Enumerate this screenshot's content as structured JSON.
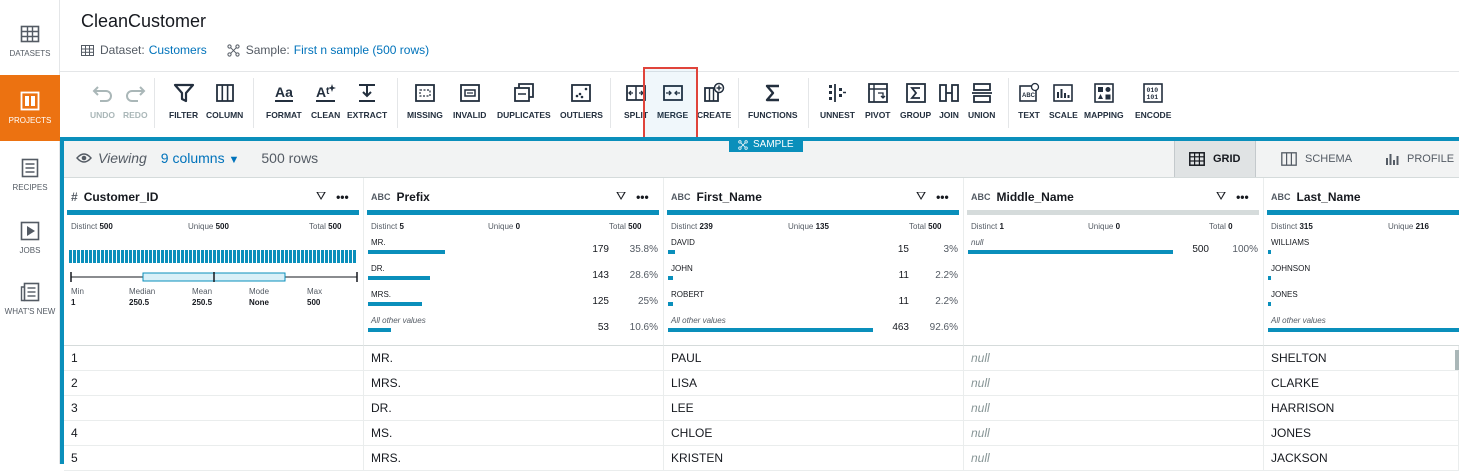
{
  "sidebar": {
    "items": [
      {
        "label": "DATASETS",
        "icon": "table-icon"
      },
      {
        "label": "PROJECTS",
        "icon": "grid-icon"
      },
      {
        "label": "RECIPES",
        "icon": "list-icon"
      },
      {
        "label": "JOBS",
        "icon": "play-icon"
      },
      {
        "label": "WHAT'S NEW",
        "icon": "news-icon"
      }
    ]
  },
  "header": {
    "title": "CleanCustomer",
    "dataset_label": "Dataset:",
    "dataset_value": "Customers",
    "sample_label": "Sample:",
    "sample_value": "First n sample (500 rows)"
  },
  "toolbar": {
    "undo": "UNDO",
    "redo": "REDO",
    "filter": "FILTER",
    "column": "COLUMN",
    "format": "FORMAT",
    "clean": "CLEAN",
    "extract": "EXTRACT",
    "missing": "MISSING",
    "invalid": "INVALID",
    "duplicates": "DUPLICATES",
    "outliers": "OUTLIERS",
    "split": "SPLIT",
    "merge": "MERGE",
    "create": "CREATE",
    "functions": "FUNCTIONS",
    "unnest": "UNNEST",
    "pivot": "PIVOT",
    "group": "GROUP",
    "join": "JOIN",
    "union": "UNION",
    "text": "TEXT",
    "scale": "SCALE",
    "mapping": "MAPPING",
    "encode": "ENCODE"
  },
  "sample_tag": "SAMPLE",
  "viewbar": {
    "viewing": "Viewing",
    "columns": "9 columns",
    "rows": "500 rows",
    "tabs": [
      "GRID",
      "SCHEMA",
      "PROFILE"
    ]
  },
  "columns": [
    {
      "name": "Customer_ID",
      "type": "#",
      "distinct_label": "Distinct",
      "distinct": "500",
      "unique_label": "Unique",
      "unique": "500",
      "total_label": "Total",
      "total": "500",
      "summary": {
        "min_label": "Min",
        "min": "1",
        "median_label": "Median",
        "median": "250.5",
        "mean_label": "Mean",
        "mean": "250.5",
        "mode_label": "Mode",
        "mode": "None",
        "max_label": "Max",
        "max": "500"
      }
    },
    {
      "name": "Prefix",
      "type": "ABC",
      "distinct_label": "Distinct",
      "distinct": "5",
      "unique_label": "Unique",
      "unique": "0",
      "total_label": "Total",
      "total": "500",
      "values": [
        {
          "label": "MR.",
          "count": "179",
          "pct": "35.8%",
          "frac": 0.358
        },
        {
          "label": "DR.",
          "count": "143",
          "pct": "28.6%",
          "frac": 0.286
        },
        {
          "label": "MRS.",
          "count": "125",
          "pct": "25%",
          "frac": 0.25
        },
        {
          "label": "All other values",
          "count": "53",
          "pct": "10.6%",
          "frac": 0.106
        }
      ]
    },
    {
      "name": "First_Name",
      "type": "ABC",
      "distinct_label": "Distinct",
      "distinct": "239",
      "unique_label": "Unique",
      "unique": "135",
      "total_label": "Total",
      "total": "500",
      "values": [
        {
          "label": "DAVID",
          "count": "15",
          "pct": "3%",
          "frac": 0.03
        },
        {
          "label": "JOHN",
          "count": "11",
          "pct": "2.2%",
          "frac": 0.022
        },
        {
          "label": "ROBERT",
          "count": "11",
          "pct": "2.2%",
          "frac": 0.022
        },
        {
          "label": "All other values",
          "count": "463",
          "pct": "92.6%",
          "frac": 0.926
        }
      ]
    },
    {
      "name": "Middle_Name",
      "type": "ABC",
      "distinct_label": "Distinct",
      "distinct": "1",
      "unique_label": "Unique",
      "unique": "0",
      "total_label": "Total",
      "total": "0",
      "values": [
        {
          "label": "null",
          "count": "500",
          "pct": "100%",
          "frac": 1.0
        }
      ]
    },
    {
      "name": "Last_Name",
      "type": "ABC",
      "distinct_label": "Distinct",
      "distinct": "315",
      "unique_label": "Unique",
      "unique": "216",
      "values": [
        {
          "label": "WILLIAMS",
          "frac": 0.01
        },
        {
          "label": "JOHNSON",
          "frac": 0.01
        },
        {
          "label": "JONES",
          "frac": 0.01
        },
        {
          "label": "All other values",
          "frac": 0.97
        }
      ]
    }
  ],
  "rows": [
    [
      "1",
      "MR.",
      "PAUL",
      "null",
      "SHELTON"
    ],
    [
      "2",
      "MRS.",
      "LISA",
      "null",
      "CLARKE"
    ],
    [
      "3",
      "DR.",
      "LEE",
      "null",
      "HARRISON"
    ],
    [
      "4",
      "MS.",
      "CHLOE",
      "null",
      "JONES"
    ],
    [
      "5",
      "MRS.",
      "KRISTEN",
      "null",
      "JACKSON"
    ]
  ],
  "colors": {
    "accent": "#0a8fbb",
    "active_nav": "#ec7211",
    "highlight": "#e0443b"
  }
}
